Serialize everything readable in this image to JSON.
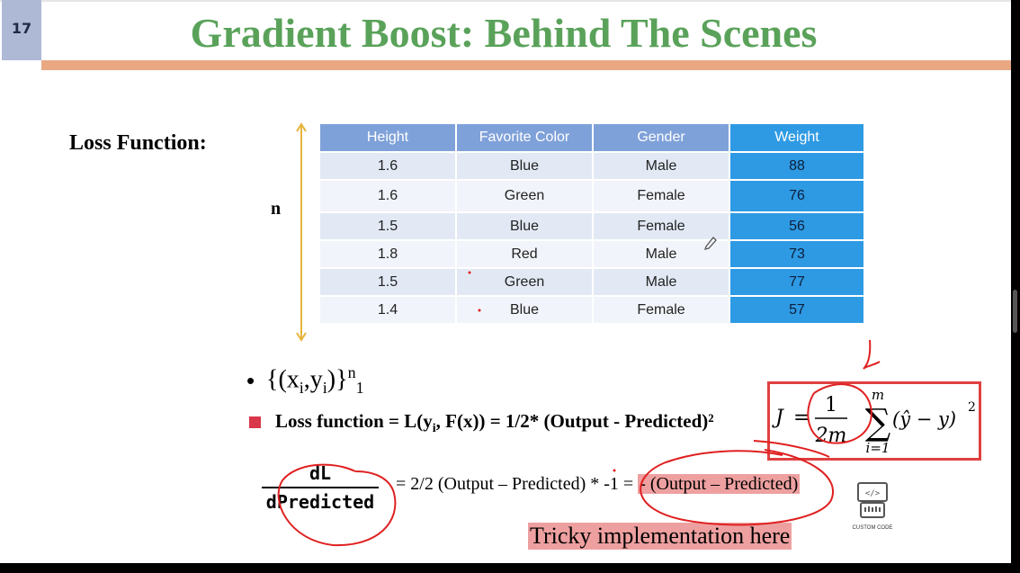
{
  "slide": {
    "number": "17",
    "title": "Gradient Boost: Behind The Scenes",
    "loss_label": "Loss Function:",
    "n_label": "n"
  },
  "table": {
    "headers": [
      "Height",
      "Favorite Color",
      "Gender",
      "Weight"
    ],
    "rows": [
      [
        "1.6",
        "Blue",
        "Male",
        "88"
      ],
      [
        "1.6",
        "Green",
        "Female",
        "76"
      ],
      [
        "1.5",
        "Blue",
        "Female",
        "56"
      ],
      [
        "1.8",
        "Red",
        "Male",
        "73"
      ],
      [
        "1.5",
        "Green",
        "Male",
        "77"
      ],
      [
        "1.4",
        "Blue",
        "Female",
        "57"
      ]
    ]
  },
  "bullets": {
    "set_open": "{(x",
    "set_i1": "i",
    "set_mid": ",y",
    "set_i2": "i",
    "set_close": ")}",
    "set_sup": "n",
    "set_sub": "1",
    "loss_prefix": "Loss function = L(y",
    "loss_sub": "i",
    "loss_suffix": ", F(x)) = 1/2* (Output - Predicted)²"
  },
  "formula": {
    "j": "J",
    "eq": "=",
    "num": "1",
    "den": "2m",
    "sum_top": "m",
    "sum_bottom": "i=1",
    "sum_symbol": "∑",
    "body": "(ŷ − y)",
    "power": "2"
  },
  "derivative": {
    "numerator": "dL",
    "denominator": "dPredicted",
    "equation": "= 2/2 (Output – Predicted) * -1 = ",
    "highlight": "- (Output – Predicted)"
  },
  "tricky_text": "Tricky implementation here",
  "custom_code": {
    "icon": "custom-code-icon",
    "label": "CUSTOM CODE"
  },
  "colors": {
    "title": "#5aa25a",
    "title_bar": "#e9a882",
    "header_bg": "#7fa1d9",
    "weight_col": "#2e9ae4",
    "annotation": "#e02020",
    "highlight": "#eea0a0"
  }
}
